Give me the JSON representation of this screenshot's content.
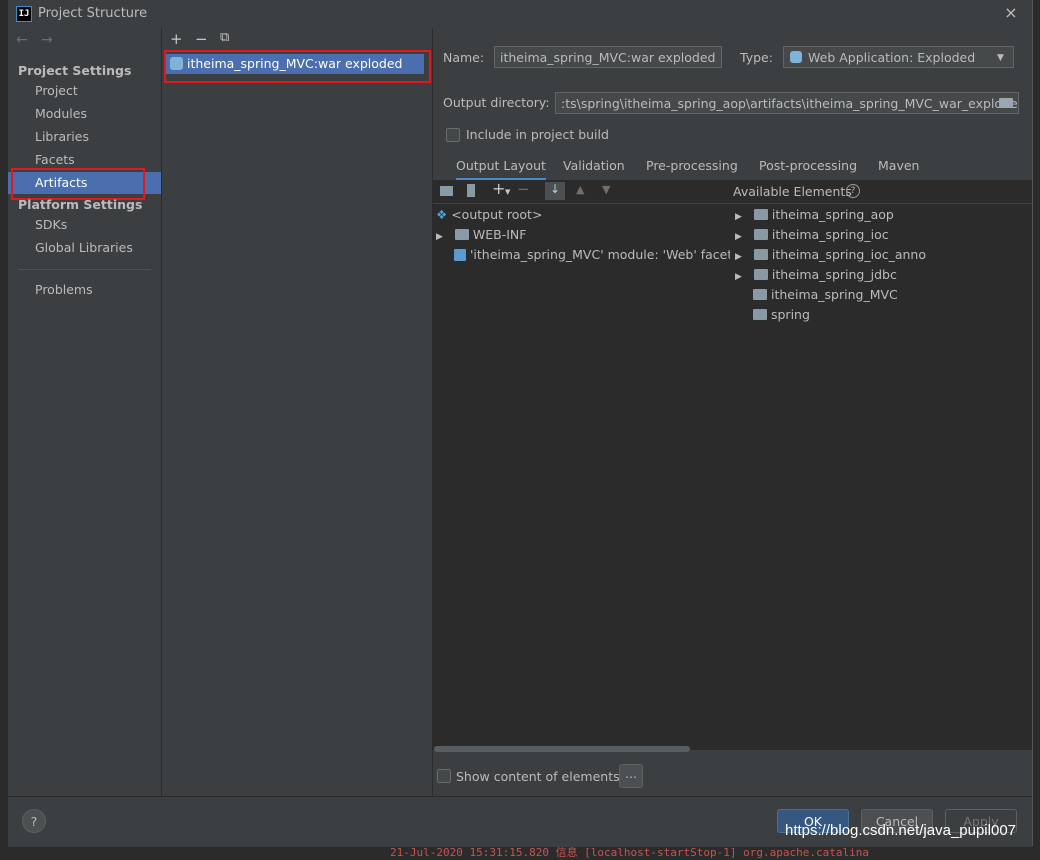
{
  "window": {
    "title": "Project Structure",
    "app_icon": "intellij-icon",
    "close": "×"
  },
  "nav": {
    "back": "←",
    "forward": "→",
    "project_settings_header": "Project Settings",
    "project_items": [
      "Project",
      "Modules",
      "Libraries",
      "Facets",
      "Artifacts"
    ],
    "selected": "Artifacts",
    "platform_settings_header": "Platform Settings",
    "platform_items": [
      "SDKs",
      "Global Libraries"
    ],
    "problems": "Problems"
  },
  "artifacts": {
    "toolbar": {
      "add": "+",
      "remove": "−",
      "copy": "⧉"
    },
    "items": [
      "itheima_spring_MVC:war exploded"
    ]
  },
  "details": {
    "name_label": "Name:",
    "name_value": "itheima_spring_MVC:war exploded",
    "type_label": "Type:",
    "type_value": "Web Application: Exploded",
    "output_dir_label": "Output directory:",
    "output_dir_value": ":ts\\spring\\itheima_spring_aop\\artifacts\\itheima_spring_MVC_war_exploded",
    "include_in_build": "Include in project build",
    "tabs": [
      "Output Layout",
      "Validation",
      "Pre-processing",
      "Post-processing",
      "Maven"
    ],
    "active_tab": "Output Layout",
    "available_elements_label": "Available Elements",
    "output_tree": [
      "<output root>",
      "WEB-INF",
      "'itheima_spring_MVC' module: 'Web' facet re"
    ],
    "available_elements": [
      "itheima_spring_aop",
      "itheima_spring_ioc",
      "itheima_spring_ioc_anno",
      "itheima_spring_jdbc",
      "itheima_spring_MVC",
      "spring"
    ],
    "show_content": "Show content of elements",
    "ellipsis_button": "..."
  },
  "buttons": {
    "help": "?",
    "ok": "OK",
    "cancel": "Cancel",
    "apply": "Apply"
  },
  "watermark": "https://blog.csdn.net/java_pupil007",
  "background_log": "21-Jul-2020 15:31:15.820 信息 [localhost-startStop-1] org.apache.catalina",
  "colors": {
    "accent": "#4b6eaf",
    "highlight_box": "#e0191f",
    "panel": "#3c3f41",
    "editor": "#2b2b2b"
  }
}
